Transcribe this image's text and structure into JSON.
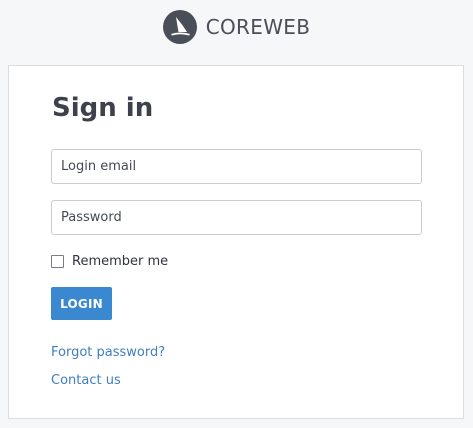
{
  "brand": {
    "name": "COREWEB",
    "logo_icon": "sail-logo-icon",
    "logo_color": "#4a4e58"
  },
  "signin": {
    "title": "Sign in",
    "email_placeholder": "Login email",
    "password_placeholder": "Password",
    "remember_label": "Remember me",
    "remember_checked": false,
    "login_label": "LOGIN",
    "forgot_link": "Forgot password?",
    "contact_link": "Contact us"
  },
  "colors": {
    "accent": "#3a88d0",
    "link": "#3f7fbf",
    "background": "#f6f7f9"
  }
}
